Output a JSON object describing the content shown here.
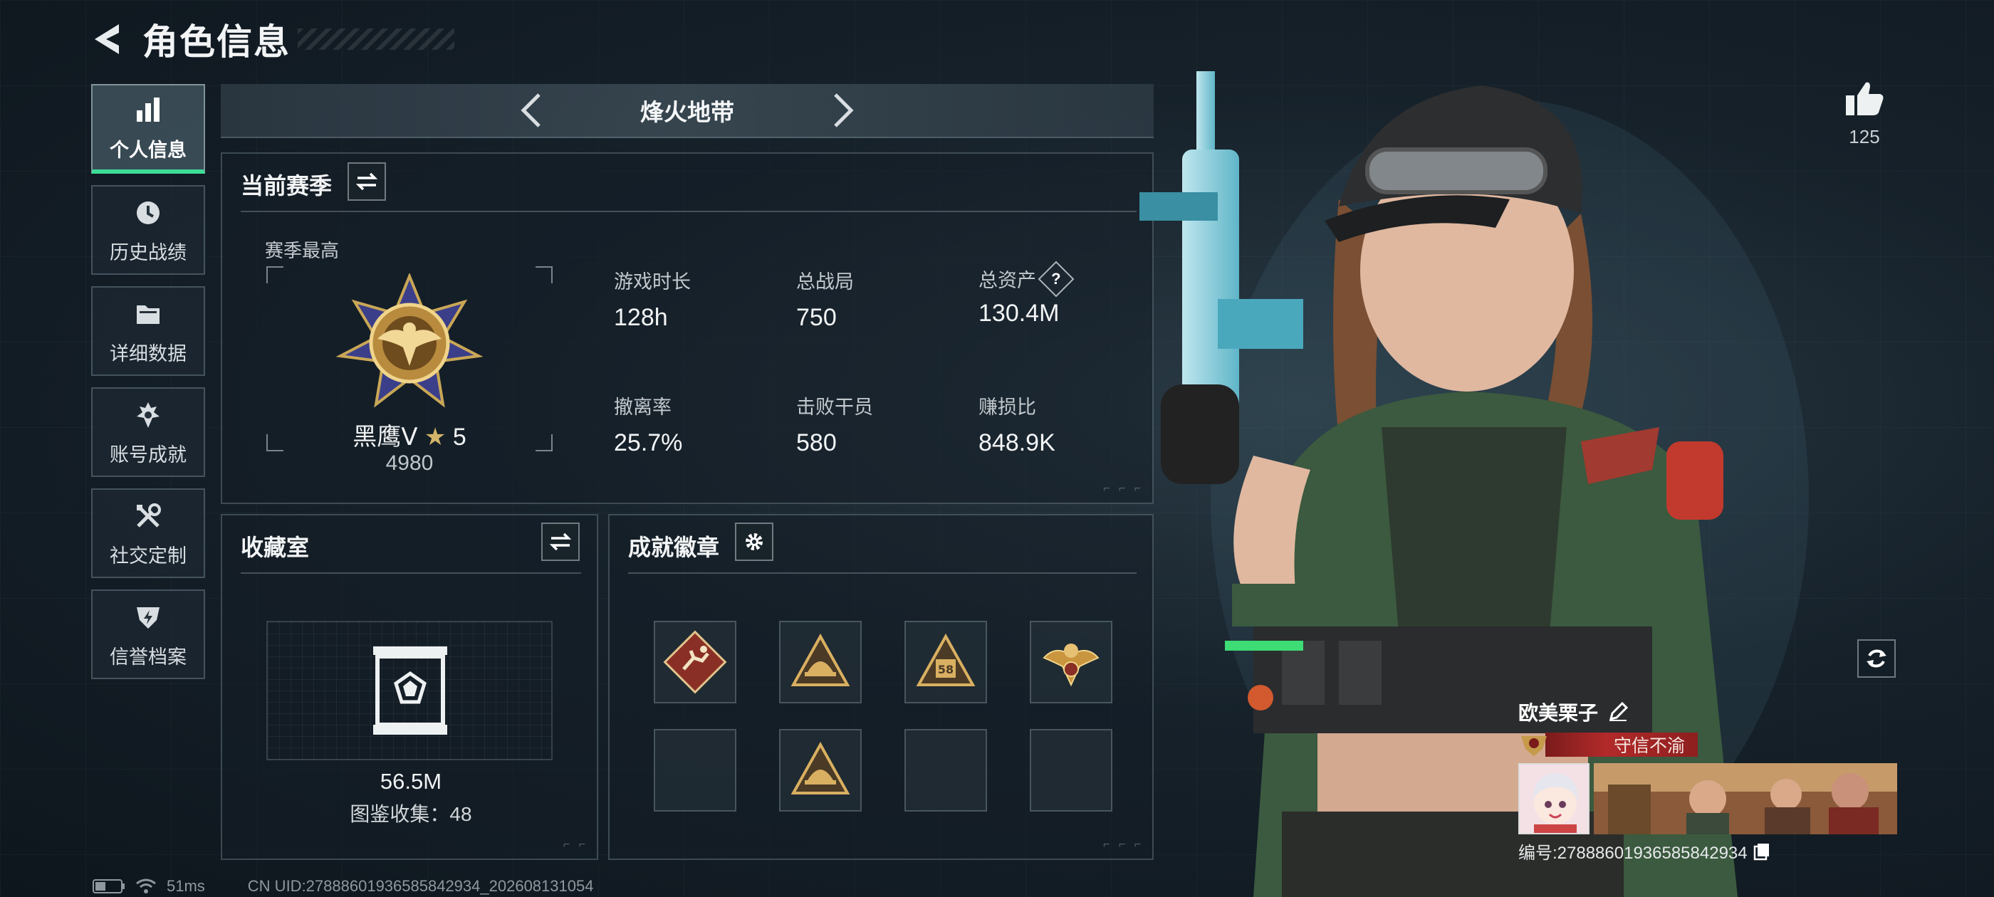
{
  "header": {
    "title": "角色信息"
  },
  "nav": {
    "items": [
      {
        "label": "个人信息",
        "icon": "bar-chart-icon",
        "active": true
      },
      {
        "label": "历史战绩",
        "icon": "history-clock-icon",
        "active": false
      },
      {
        "label": "详细数据",
        "icon": "folder-icon",
        "active": false
      },
      {
        "label": "账号成就",
        "icon": "achievement-icon",
        "active": false
      },
      {
        "label": "社交定制",
        "icon": "tools-icon",
        "active": false
      },
      {
        "label": "信誉档案",
        "icon": "credit-shield-icon",
        "active": false
      }
    ]
  },
  "mode": {
    "title": "烽火地带"
  },
  "season": {
    "title": "当前赛季",
    "subtitle": "赛季最高",
    "rank_name": "黑鹰Ⅴ",
    "rank_star": "★",
    "rank_stars": "5",
    "rank_score": "4980",
    "stats": [
      {
        "label": "游戏时长",
        "value": "128h"
      },
      {
        "label": "总战局",
        "value": "750"
      },
      {
        "label": "总资产",
        "value": "130.4M",
        "help": "?"
      },
      {
        "label": "撤离率",
        "value": "25.7%"
      },
      {
        "label": "击败干员",
        "value": "580"
      },
      {
        "label": "赚损比",
        "value": "848.9K"
      }
    ]
  },
  "collection": {
    "title": "收藏室",
    "value": "56.5M",
    "count_label": "图鉴收集：48"
  },
  "badges": {
    "title": "成就徽章",
    "slots": [
      {
        "icon": "runner-badge-icon",
        "filled": true
      },
      {
        "icon": "helmet-badge-icon",
        "filled": true
      },
      {
        "icon": "level-58-badge-icon",
        "filled": true
      },
      {
        "icon": "eagle-badge-icon",
        "filled": true
      },
      {
        "icon": "empty-slot",
        "filled": false
      },
      {
        "icon": "helmet-badge-icon",
        "filled": true
      },
      {
        "icon": "empty-slot",
        "filled": false
      },
      {
        "icon": "empty-slot",
        "filled": false
      }
    ]
  },
  "profile": {
    "likes": "125",
    "player_name": "欧美栗子",
    "player_title": "守信不渝",
    "player_id": "编号:2788860193658584293­4"
  },
  "status": {
    "ping": "51ms",
    "uid": "CN UID:27888601936585842934_202608131054"
  },
  "colors": {
    "accent": "#3ddc97",
    "title_banner": "#b22a2a",
    "gold": "#d4b36a"
  }
}
